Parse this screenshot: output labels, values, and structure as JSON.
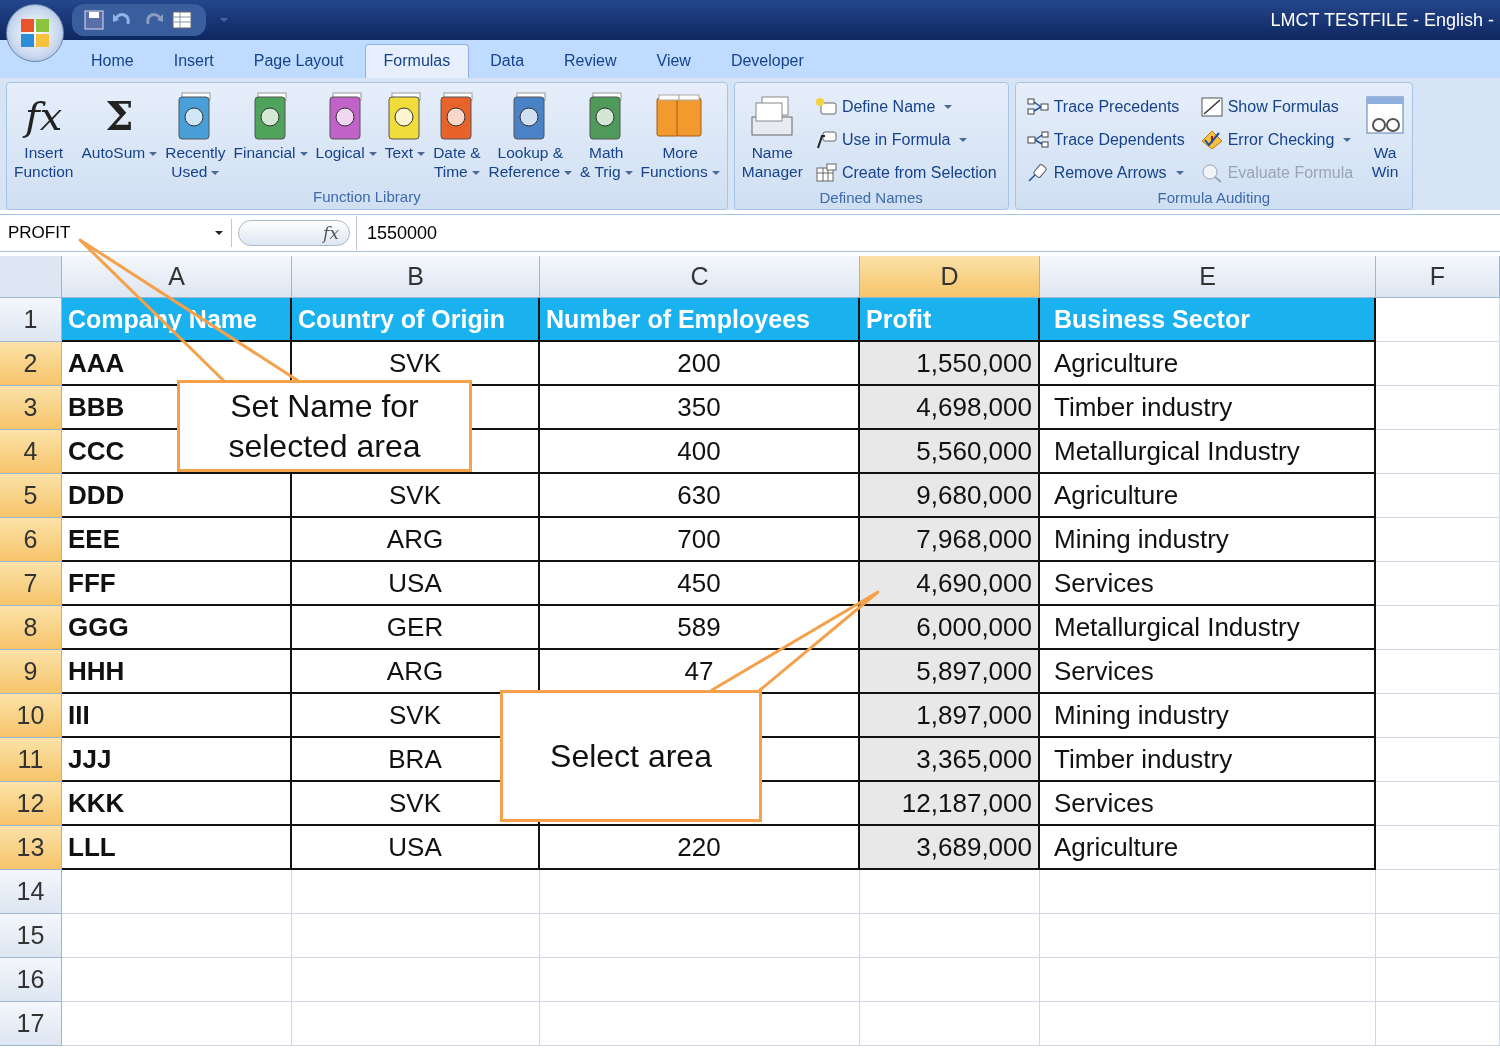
{
  "window": {
    "title": "LMCT TESTFILE - English -"
  },
  "tabs": [
    {
      "label": "Home",
      "selected": false
    },
    {
      "label": "Insert",
      "selected": false
    },
    {
      "label": "Page Layout",
      "selected": false
    },
    {
      "label": "Formulas",
      "selected": true
    },
    {
      "label": "Data",
      "selected": false
    },
    {
      "label": "Review",
      "selected": false
    },
    {
      "label": "View",
      "selected": false
    },
    {
      "label": "Developer",
      "selected": false
    }
  ],
  "ribbon": {
    "groups": [
      {
        "title": "Function Library",
        "items": [
          {
            "kind": "large",
            "symbol": "fx",
            "label": "Insert\nFunction",
            "dropdown": false
          },
          {
            "kind": "large",
            "symbol": "Σ",
            "label": "AutoSum",
            "dropdown": true
          },
          {
            "kind": "large",
            "label": "Recently\nUsed",
            "dropdown": true
          },
          {
            "kind": "large",
            "label": "Financial",
            "dropdown": true
          },
          {
            "kind": "large",
            "label": "Logical",
            "dropdown": true
          },
          {
            "kind": "large",
            "label": "Text",
            "dropdown": true
          },
          {
            "kind": "large",
            "label": "Date &\nTime",
            "dropdown": true
          },
          {
            "kind": "large",
            "label": "Lookup &\nReference",
            "dropdown": true
          },
          {
            "kind": "large",
            "label": "Math\n& Trig",
            "dropdown": true
          },
          {
            "kind": "large",
            "label": "More\nFunctions",
            "dropdown": true
          }
        ]
      },
      {
        "title": "Defined Names",
        "items": [
          {
            "kind": "large",
            "label": "Name\nManager",
            "dropdown": false
          },
          {
            "kind": "small",
            "label": "Define Name",
            "dropdown": true,
            "disabled": false
          },
          {
            "kind": "small",
            "label": "Use in Formula",
            "dropdown": true,
            "disabled": false
          },
          {
            "kind": "small",
            "label": "Create from Selection",
            "dropdown": false,
            "disabled": false
          }
        ]
      },
      {
        "title": "Formula Auditing",
        "items": [
          {
            "kind": "small",
            "label": "Trace Precedents",
            "dropdown": false,
            "disabled": false
          },
          {
            "kind": "small",
            "label": "Trace Dependents",
            "dropdown": false,
            "disabled": false
          },
          {
            "kind": "small",
            "label": "Remove Arrows",
            "dropdown": true,
            "disabled": false
          },
          {
            "kind": "small",
            "label": "Show Formulas",
            "dropdown": false,
            "disabled": false
          },
          {
            "kind": "small",
            "label": "Error Checking",
            "dropdown": true,
            "disabled": false
          },
          {
            "kind": "small",
            "label": "Evaluate Formula",
            "dropdown": false,
            "disabled": true
          },
          {
            "kind": "large",
            "label": "Wa\nWin",
            "dropdown": false
          }
        ]
      }
    ]
  },
  "formula_bar": {
    "name_box": "PROFIT",
    "function_label": "fx",
    "value": "1550000"
  },
  "sheet": {
    "columns": [
      {
        "label": "A",
        "selected": false
      },
      {
        "label": "B",
        "selected": false
      },
      {
        "label": "C",
        "selected": false
      },
      {
        "label": "D",
        "selected": true
      },
      {
        "label": "E",
        "selected": false
      },
      {
        "label": "F",
        "selected": false
      }
    ],
    "rows": [
      {
        "number": "1",
        "kind": "header",
        "selected": false,
        "cells": [
          "Company Name",
          "Country of Origin",
          "Number of Employees",
          "Profit",
          "Business Sector"
        ]
      },
      {
        "number": "2",
        "kind": "data",
        "selected": true,
        "cells": [
          "AAA",
          "SVK",
          "200",
          "1,550,000",
          "Agriculture"
        ]
      },
      {
        "number": "3",
        "kind": "data",
        "selected": true,
        "cells": [
          "BBB",
          null,
          "350",
          "4,698,000",
          "Timber industry"
        ]
      },
      {
        "number": "4",
        "kind": "data",
        "selected": true,
        "cells": [
          "CCC",
          null,
          "400",
          "5,560,000",
          "Metallurgical Industry"
        ]
      },
      {
        "number": "5",
        "kind": "data",
        "selected": true,
        "cells": [
          "DDD",
          "SVK",
          "630",
          "9,680,000",
          "Agriculture"
        ]
      },
      {
        "number": "6",
        "kind": "data",
        "selected": true,
        "cells": [
          "EEE",
          "ARG",
          "700",
          "7,968,000",
          "Mining industry"
        ]
      },
      {
        "number": "7",
        "kind": "data",
        "selected": true,
        "cells": [
          "FFF",
          "USA",
          "450",
          "4,690,000",
          "Services"
        ]
      },
      {
        "number": "8",
        "kind": "data",
        "selected": true,
        "cells": [
          "GGG",
          "GER",
          "589",
          "6,000,000",
          "Metallurgical Industry"
        ]
      },
      {
        "number": "9",
        "kind": "data",
        "selected": true,
        "cells": [
          "HHH",
          "ARG",
          "47",
          "5,897,000",
          "Services"
        ]
      },
      {
        "number": "10",
        "kind": "data",
        "selected": true,
        "cells": [
          "III",
          "SVK",
          null,
          "1,897,000",
          "Mining industry"
        ]
      },
      {
        "number": "11",
        "kind": "data",
        "selected": true,
        "cells": [
          "JJJ",
          "BRA",
          null,
          "3,365,000",
          "Timber industry"
        ]
      },
      {
        "number": "12",
        "kind": "data",
        "selected": true,
        "cells": [
          "KKK",
          "SVK",
          null,
          "12,187,000",
          "Services"
        ]
      },
      {
        "number": "13",
        "kind": "data",
        "selected": true,
        "cells": [
          "LLL",
          "USA",
          "220",
          "3,689,000",
          "Agriculture"
        ]
      },
      {
        "number": "14",
        "kind": "empty",
        "selected": false
      },
      {
        "number": "15",
        "kind": "empty",
        "selected": false
      },
      {
        "number": "16",
        "kind": "empty",
        "selected": false
      },
      {
        "number": "17",
        "kind": "empty",
        "selected": false
      }
    ]
  },
  "callouts": [
    {
      "text": "Set Name for\nselected area"
    },
    {
      "text": "Select area"
    }
  ]
}
